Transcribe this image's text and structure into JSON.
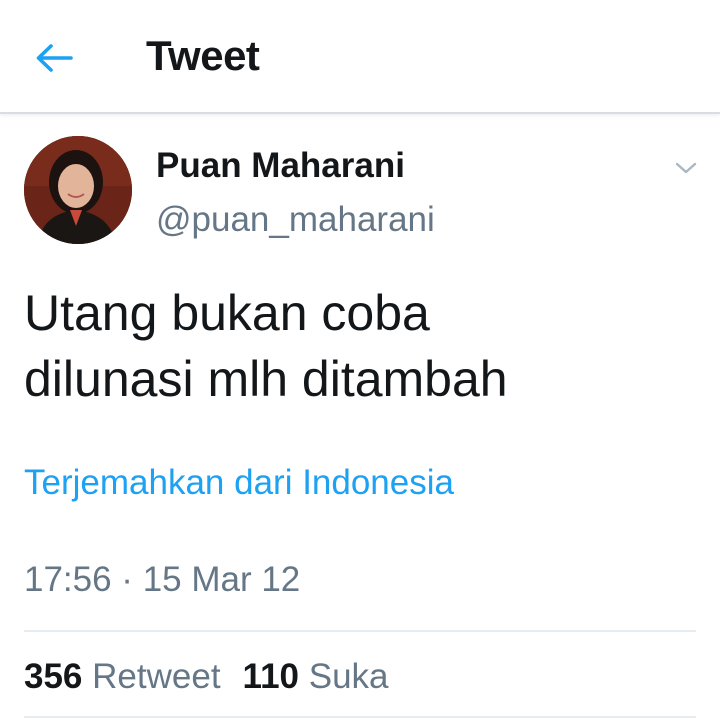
{
  "header": {
    "back_icon": "back-arrow-icon",
    "title": "Tweet"
  },
  "author": {
    "display_name": "Puan Maharani",
    "handle": "@puan_maharani",
    "menu_icon": "chevron-down-icon"
  },
  "tweet": {
    "text_line1": "Utang bukan coba",
    "text_line2": "dilunasi mlh ditambah",
    "translate_label": "Terjemahkan dari Indonesia",
    "timestamp": "17:56 · 15 Mar 12"
  },
  "stats": {
    "retweets_count": "356",
    "retweets_label": "Retweet",
    "likes_count": "110",
    "likes_label": "Suka"
  },
  "colors": {
    "accent": "#1da1f2",
    "text_primary": "#14171a",
    "text_secondary": "#657786",
    "divider": "#e6ecf0"
  }
}
